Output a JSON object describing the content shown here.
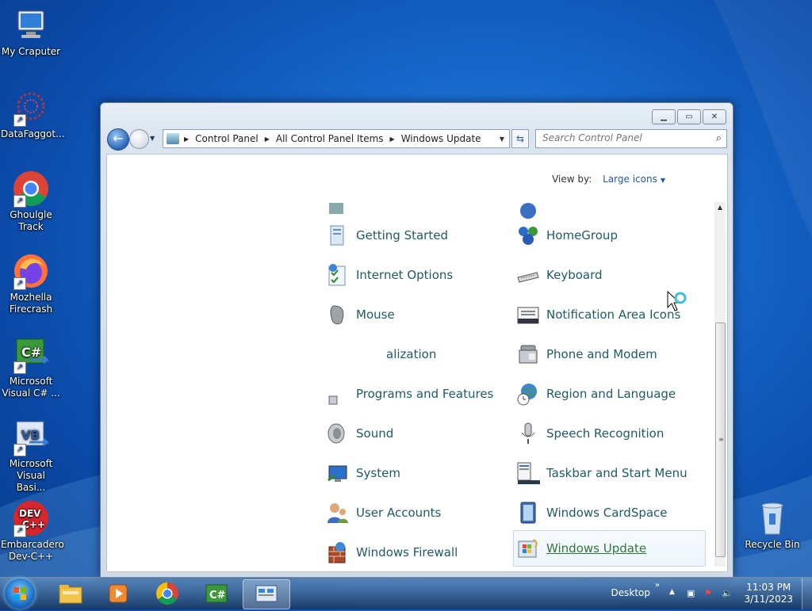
{
  "desktop": {
    "icons": [
      {
        "label": "My Craputer"
      },
      {
        "label": "DataFaggot..."
      },
      {
        "label": "Ghoulgle Track"
      },
      {
        "label": "Mozhella Firecrash"
      },
      {
        "label": "Microsoft Visual C# ..."
      },
      {
        "label": "Microsoft Visual Basi..."
      },
      {
        "label": "Embarcadero Dev-C++"
      },
      {
        "label": "Recycle Bin"
      }
    ]
  },
  "window": {
    "address": {
      "crumbs": [
        "Control Panel",
        "All Control Panel Items",
        "Windows Update"
      ]
    },
    "search": {
      "placeholder": "Search Control Panel"
    },
    "view_by": {
      "label": "View by:",
      "value": "Large icons"
    },
    "items_left": [
      "Getting Started",
      "Internet Options",
      "Mouse",
      "alization",
      "Programs and Features",
      "Sound",
      "System",
      "User Accounts",
      "Windows Firewall"
    ],
    "items_right": [
      "HomeGroup",
      "Keyboard",
      "Notification Area Icons",
      "Phone and Modem",
      "Region and Language",
      "Speech Recognition",
      "Taskbar and Start Menu",
      "Windows CardSpace",
      "Windows Update"
    ]
  },
  "taskbar": {
    "desktop_label": "Desktop",
    "time": "11:03 PM",
    "date": "3/11/2023"
  },
  "colors": {
    "item_text": "#1f5a67",
    "link": "#1e5ba8"
  }
}
